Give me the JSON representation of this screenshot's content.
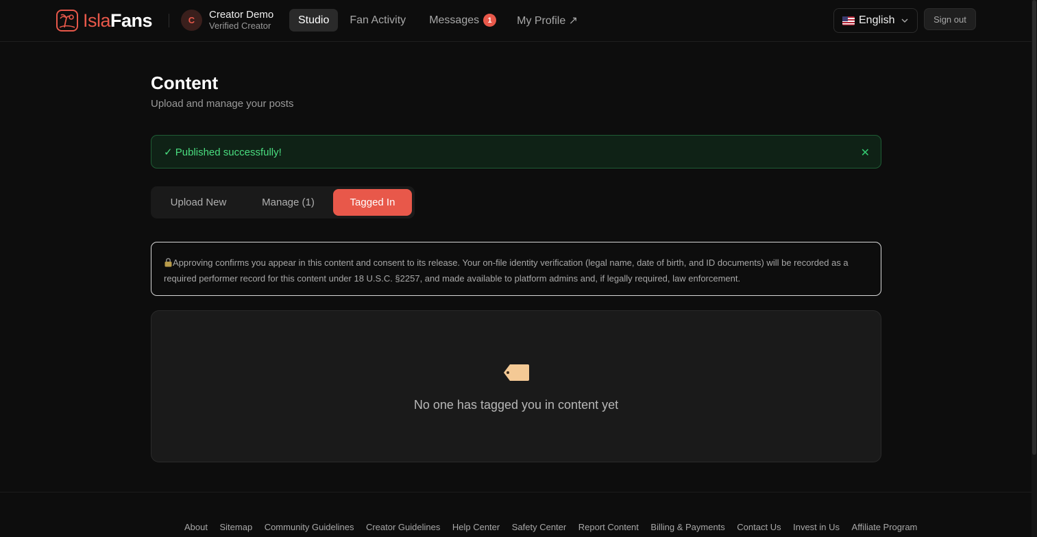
{
  "header": {
    "logo_isla": "Isla",
    "logo_fans": "Fans",
    "user": {
      "initial": "C",
      "name": "Creator Demo",
      "role": "Verified Creator"
    },
    "nav": [
      {
        "label": "Studio",
        "active": true
      },
      {
        "label": "Fan Activity",
        "active": false
      },
      {
        "label": "Messages",
        "active": false,
        "badge": "1"
      },
      {
        "label": "My Profile ↗",
        "active": false
      }
    ],
    "language": "English",
    "sign_out": "Sign out"
  },
  "main": {
    "title": "Content",
    "subtitle": "Upload and manage your posts",
    "toast": {
      "message": "✓ Published successfully!",
      "close": "✕",
      "color": "#4ade80"
    },
    "tabs": [
      {
        "label": "Upload New",
        "active": false
      },
      {
        "label": "Manage (1)",
        "active": false
      },
      {
        "label": "Tagged In",
        "active": true
      }
    ],
    "notice": {
      "icon": "lock-icon",
      "text": "Approving confirms you appear in this content and consent to its release. Your on-file identity verification (legal name, date of birth, and ID documents) will be recorded as a required performer record for this content under 18 U.S.C. §2257, and made available to platform admins and, if legally required, law enforcement."
    },
    "empty_state": {
      "icon": "tag-icon",
      "text": "No one has tagged you in content yet"
    }
  },
  "footer": {
    "links": [
      "About",
      "Sitemap",
      "Community Guidelines",
      "Creator Guidelines",
      "Help Center",
      "Safety Center",
      "Report Content",
      "Billing & Payments",
      "Contact Us",
      "Invest in Us",
      "Affiliate Program"
    ]
  },
  "colors": {
    "accent": "#e8584a",
    "background": "#0d0d0d",
    "success": "#4ade80"
  }
}
